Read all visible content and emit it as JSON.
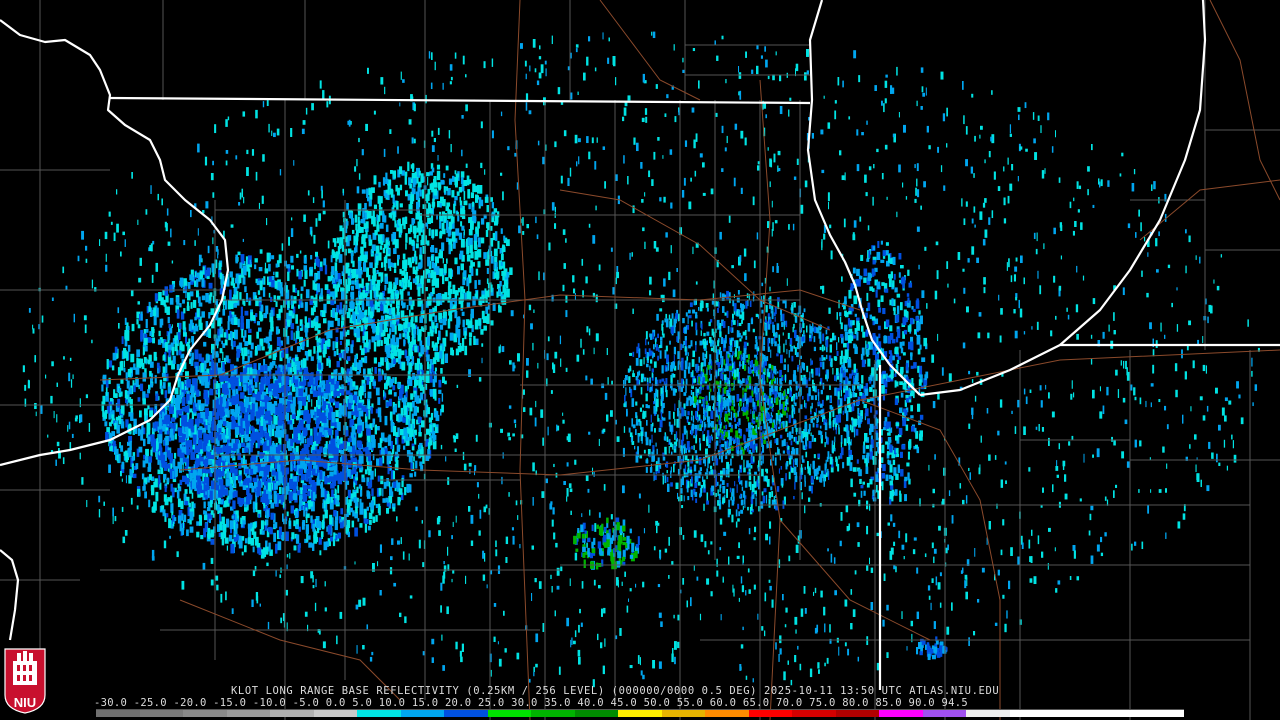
{
  "product": {
    "title": "KLOT LONG RANGE BASE REFLECTIVITY (0.25KM / 256 LEVEL) (000000/0000 0.5 DEG) 2025-10-11 13:50 UTC  ATLAS.NIU.EDU"
  },
  "scale": {
    "labels_text": "-30.0 -25.0 -20.0 -15.0 -10.0 -5.0  0.0   5.0  10.0  15.0  20.0  25.0  30.0  35.0  40.0  45.0  50.0  55.0  60.0  65.0  70.0  75.0  80.0  85.0  90.0  94.5",
    "colors": [
      "#6f6f6f",
      "#7b7b7b",
      "#8a8a8a",
      "#9a9a9a",
      "#b0b0b0",
      "#c8c8c8",
      "#00e4e4",
      "#00a6f0",
      "#0050e0",
      "#00e000",
      "#00b400",
      "#008c00",
      "#fff000",
      "#e6b400",
      "#ff8c00",
      "#ff0000",
      "#d40000",
      "#b00000",
      "#ff00ff",
      "#a050f0",
      "#f0f0f0",
      "#ffffff",
      "#ffffff",
      "#ffffff",
      "#ffffff"
    ]
  },
  "logo": {
    "text": "NIU",
    "colors": {
      "background": "#c8102e",
      "foreground": "#ffffff"
    }
  },
  "colors": {
    "state_line": "#ffffff",
    "county_line": "#555555",
    "highway": "#8b4a2b"
  }
}
